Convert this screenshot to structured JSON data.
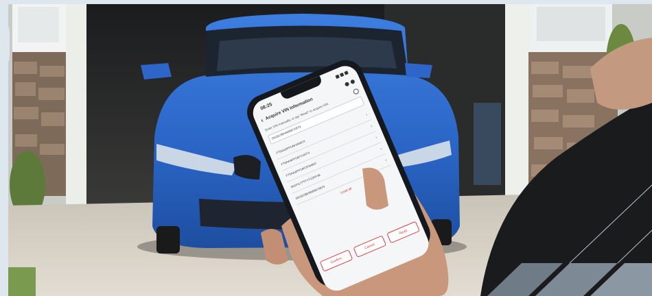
{
  "phone": {
    "status_time": "08:25",
    "title": "Acquire VIN Information",
    "hint": "Enter VIN manually, or tap \"Read\" to acquire VIN.",
    "vin_value": "5N1BJ3BH6MN670879",
    "vin_list": [
      "FT5AAAPF0AVI4W874",
      "FT5AAAPF0AP1VI0T4",
      "FT5AAAPF0AP2F94802",
      "5N1FG7TTFYT1OFF38",
      "5N1BJ3BH6MN670879"
    ],
    "more_label": "Load all",
    "buttons": [
      "Confirm",
      "Cancel",
      "Read"
    ]
  },
  "colors": {
    "car_blue": "#2f6fd6",
    "sky": "#dfe7ee",
    "accent_red": "#d94040"
  }
}
